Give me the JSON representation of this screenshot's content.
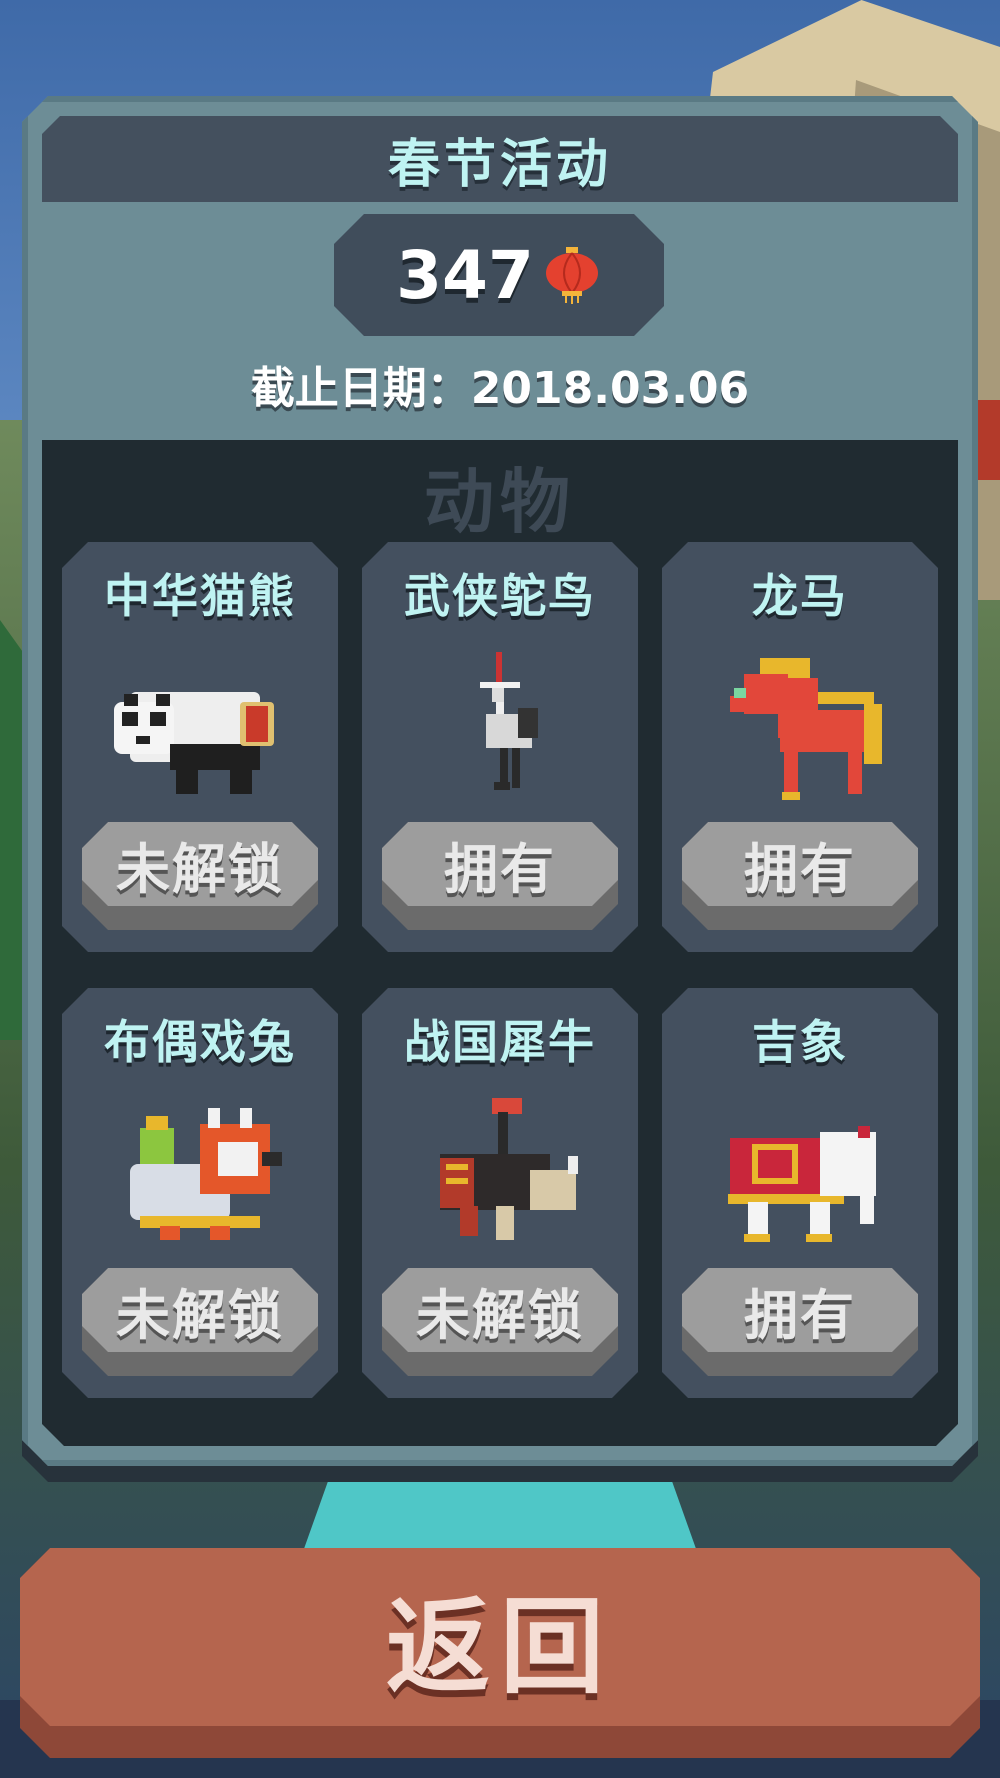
{
  "event": {
    "title": "春节活动",
    "currency_count": "347",
    "currency_icon": "lantern-icon",
    "deadline": "截止日期：2018.03.06"
  },
  "animals_section": {
    "title": "动物",
    "cards": [
      {
        "name": "中华猫熊",
        "status": "未解锁",
        "icon": "panda-icon"
      },
      {
        "name": "武侠鸵鸟",
        "status": "拥有",
        "icon": "ostrich-icon"
      },
      {
        "name": "龙马",
        "status": "拥有",
        "icon": "dragon-horse-icon"
      },
      {
        "name": "布偶戏兔",
        "status": "未解锁",
        "icon": "lion-dance-rabbit-icon"
      },
      {
        "name": "战国犀牛",
        "status": "未解锁",
        "icon": "warrior-rhino-icon"
      },
      {
        "name": "吉象",
        "status": "拥有",
        "icon": "lucky-elephant-icon"
      }
    ]
  },
  "back_button": {
    "label": "返回"
  },
  "colors": {
    "panel": "#6d8d96",
    "card": "#44505f",
    "title_text": "#bff3f2",
    "status_button": "#9d9d9d",
    "back_button": "#b5654e"
  }
}
